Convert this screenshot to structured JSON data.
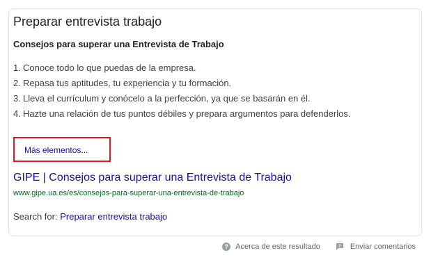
{
  "card": {
    "title": "Preparar entrevista trabajo",
    "snippet_heading": "Consejos para superar una Entrevista de Trabajo",
    "steps": [
      {
        "num": "1.",
        "text": "Conoce todo lo que puedas de la empresa."
      },
      {
        "num": "2.",
        "text": "Repasa tus aptitudes, tu experiencia y tu formación."
      },
      {
        "num": "3.",
        "text": "Lleva el currículum y conócelo a la perfección, ya que se basarán en él."
      },
      {
        "num": "4.",
        "text": "Hazte una relación de tus puntos débiles y prepara argumentos para defenderlos."
      }
    ],
    "more_link": "Más elementos...",
    "result_title": "GIPE | Consejos para superar una Entrevista de Trabajo",
    "result_url": "www.gipe.ua.es/es/consejos-para-superar-una-entrevista-de-trabajo",
    "search_for_label": "Search for:",
    "search_for_query": "Preparar entrevista trabajo"
  },
  "footer": {
    "about_label": "Acerca de este resultado",
    "feedback_label": "Enviar comentarios"
  },
  "colors": {
    "link": "#1a0dab",
    "url_green": "#006621",
    "highlight_red": "#e8141e"
  },
  "icons": {
    "about": "help-circle-icon",
    "feedback": "feedback-flag-icon"
  }
}
